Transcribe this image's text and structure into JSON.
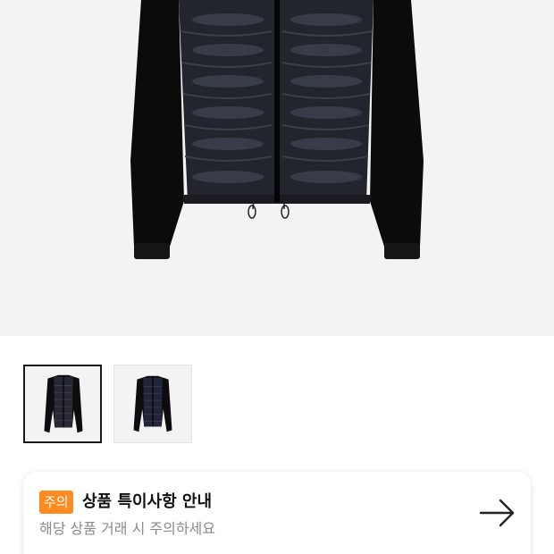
{
  "product": {
    "main_image_icon": "jacket-image",
    "thumbnails": [
      {
        "icon": "jacket-thumbnail-icon",
        "selected": true
      },
      {
        "icon": "jacket-thumbnail-icon",
        "selected": false
      }
    ]
  },
  "notice": {
    "badge": "주의",
    "title": "상품 특이사항 안내",
    "subtitle": "해당 상품 거래 시 주의하세요",
    "arrow_icon": "arrow-right-icon"
  },
  "colors": {
    "badge": "#ff8a1f",
    "image_background": "#f3f3f3",
    "title": "#111111",
    "subtitle": "#8a8a8a"
  }
}
